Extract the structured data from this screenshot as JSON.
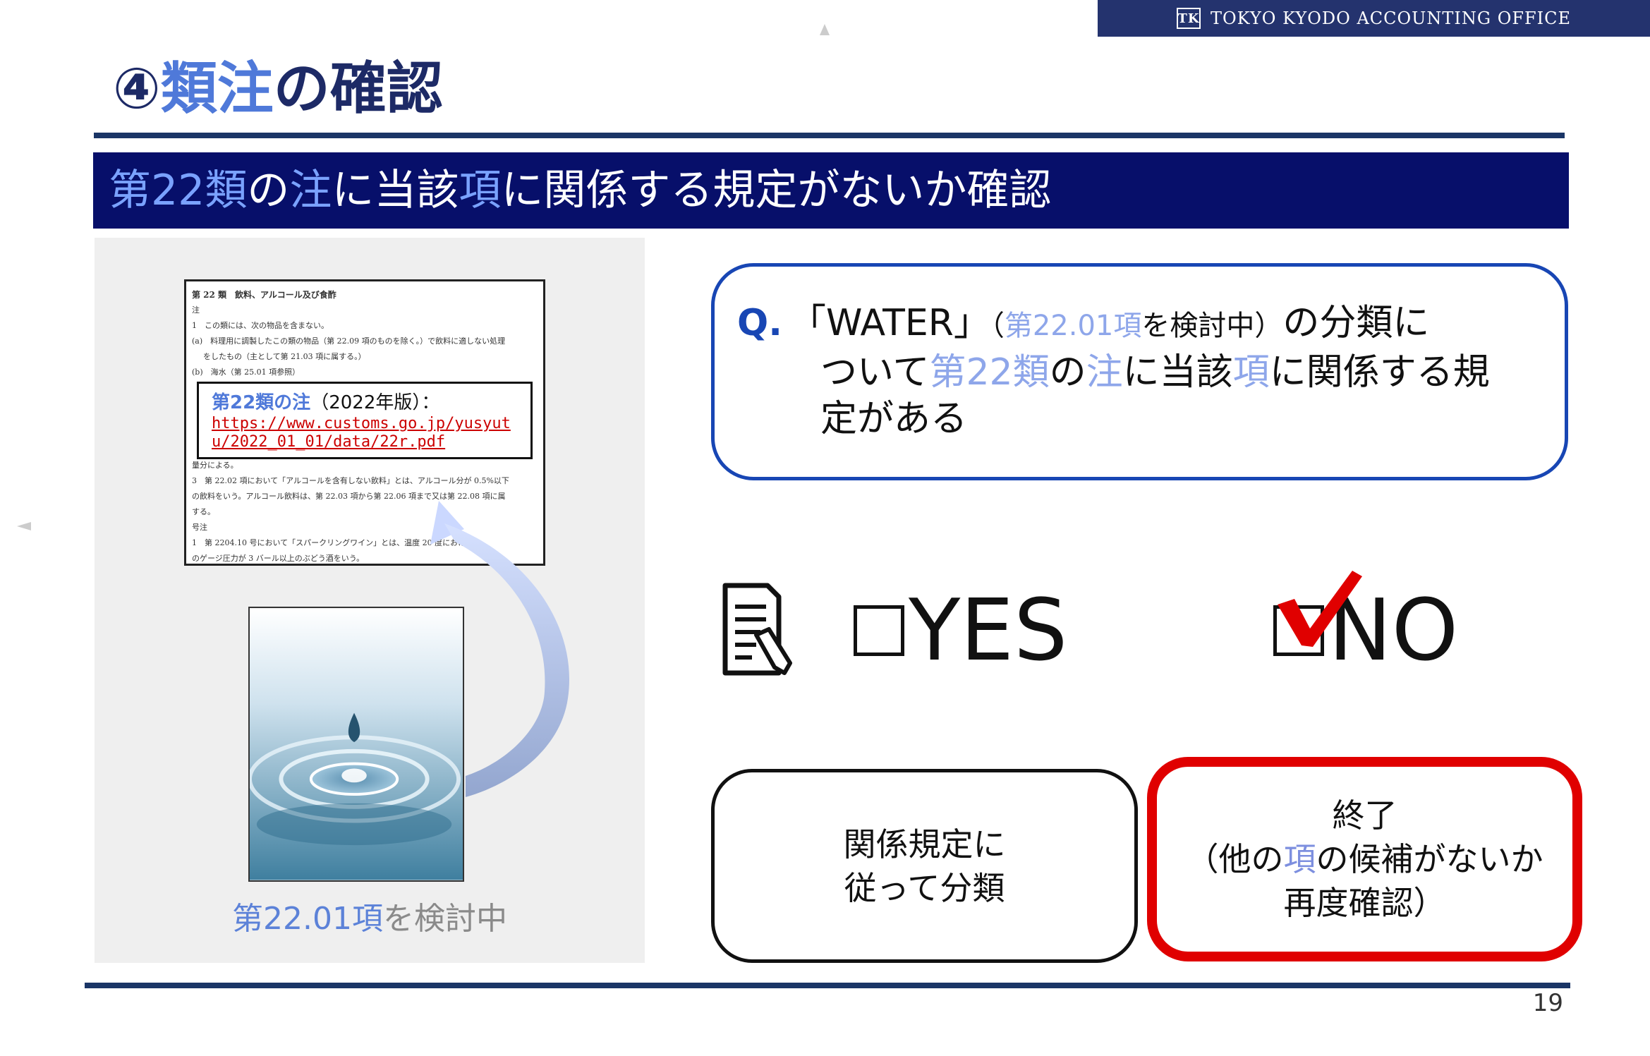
{
  "brand": {
    "logo": "TK",
    "name": "TOKYO KYODO ACCOUNTING OFFICE"
  },
  "title": {
    "prefix": "④",
    "highlight": "類注",
    "suffix": "の確認"
  },
  "subtitle": {
    "p1": "第22類",
    "p2": "の",
    "p3": "注",
    "p4": "に当該",
    "p5": "項",
    "p6": "に関係する規定がないか確認"
  },
  "doc_excerpt": {
    "heading": "第 22 類　飲料、アルコール及び食酢",
    "lines": [
      "注",
      "1　この類には、次の物品を含まない。",
      "(a)　料理用に調製したこの類の物品（第 22.09 項のものを除く。）で飲料に適しない処理",
      "をしたもの（主として第 21.03 項に属する。）",
      "(b)　海水（第 25.01 項参照）",
      "量分による。",
      "3　第 22.02 項において「アルコールを含有しない飲料」とは、アルコール分が 0.5%以下",
      "の飲料をいう。アルコール飲料は、第 22.03 項から第 22.06 項まで又は第 22.08 項に属",
      "する。",
      "号注",
      "1　第 2204.10 号において「スパークリングワイン」とは、温度 20 度における",
      "のゲージ圧力が 3 バール以上のぶどう酒をいう。"
    ]
  },
  "note": {
    "title_bold": "第22類の注",
    "title_rest": "（2022年版）：",
    "url": "https://www.customs.go.jp/yusyutu/2022_01_01/data/22r.pdf"
  },
  "water_caption": {
    "highlight": "第22.01項",
    "rest": "を検討中"
  },
  "question": {
    "label": "Q.",
    "l1a": "「WATER」",
    "l1b": "（",
    "l1c": "第22.01項",
    "l1d": "を検討中）",
    "l1e": "の分類に",
    "l2a": "ついて",
    "l2b": "第22類",
    "l2c": "の",
    "l2d": "注",
    "l2e": "に当該",
    "l2f": "項",
    "l2g": "に関係する規",
    "l3": "定がある"
  },
  "choices": {
    "yes": "YES",
    "no": "NO",
    "selected": "no"
  },
  "answers": {
    "yes_l1": "関係規定に",
    "yes_l2": "従って分類",
    "no_l1": "終了",
    "no_l2a": "（他の",
    "no_l2b": "項",
    "no_l2c": "の候補がないか",
    "no_l3": "再度確認）"
  },
  "page_number": "19",
  "colors": {
    "navy": "#070f6a",
    "accent_blue": "#1846b4",
    "highlight_red": "#e00000"
  }
}
